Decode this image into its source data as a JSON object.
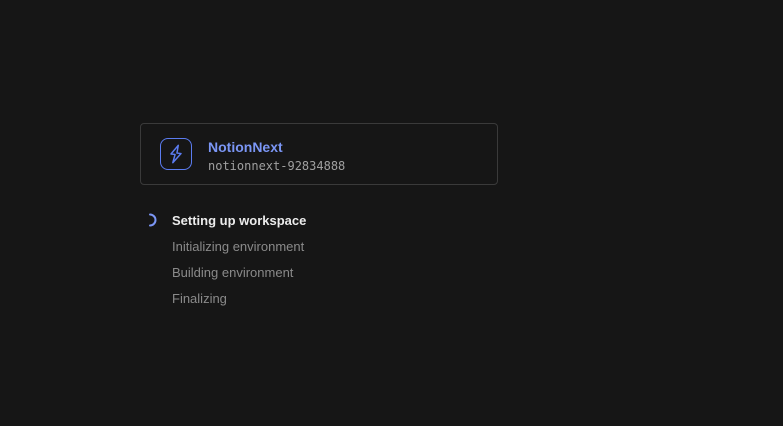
{
  "project": {
    "name": "NotionNext",
    "id": "notionnext-92834888",
    "logo_icon": "bolt-logo-icon"
  },
  "steps": [
    {
      "label": "Setting up workspace",
      "status": "in-progress"
    },
    {
      "label": "Initializing environment",
      "status": "pending"
    },
    {
      "label": "Building environment",
      "status": "pending"
    },
    {
      "label": "Finalizing",
      "status": "pending"
    }
  ],
  "colors": {
    "background": "#161616",
    "accent": "#7b96f5",
    "card_border": "#3a3a3a",
    "active_text": "#ececec",
    "pending_text": "#8a8a8a"
  }
}
